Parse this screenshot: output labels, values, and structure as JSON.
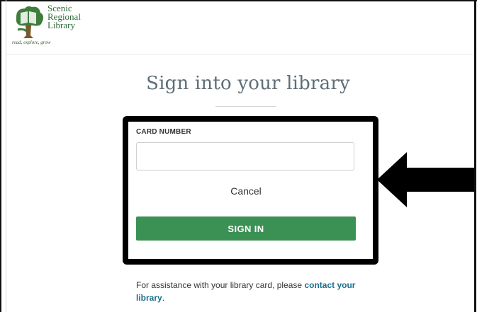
{
  "header": {
    "logo_line1": "Scenic",
    "logo_line2": "Regional",
    "logo_line3": "Library",
    "logo_tagline": "read, explore, grow"
  },
  "page": {
    "title": "Sign into your library"
  },
  "form": {
    "card_label": "CARD NUMBER",
    "card_value": "",
    "cancel_label": "Cancel",
    "signin_label": "SIGN IN"
  },
  "assistance": {
    "text_before": "For assistance with your library card, please ",
    "link_text": "contact your library",
    "text_after": "."
  },
  "colors": {
    "brand_green": "#2f6a3b",
    "button_green": "#3b9153",
    "link_blue": "#1b6f8c",
    "highlight": "#000000"
  },
  "icons": {
    "logo": "tree-book-logo",
    "annotation": "left-arrow-icon"
  }
}
